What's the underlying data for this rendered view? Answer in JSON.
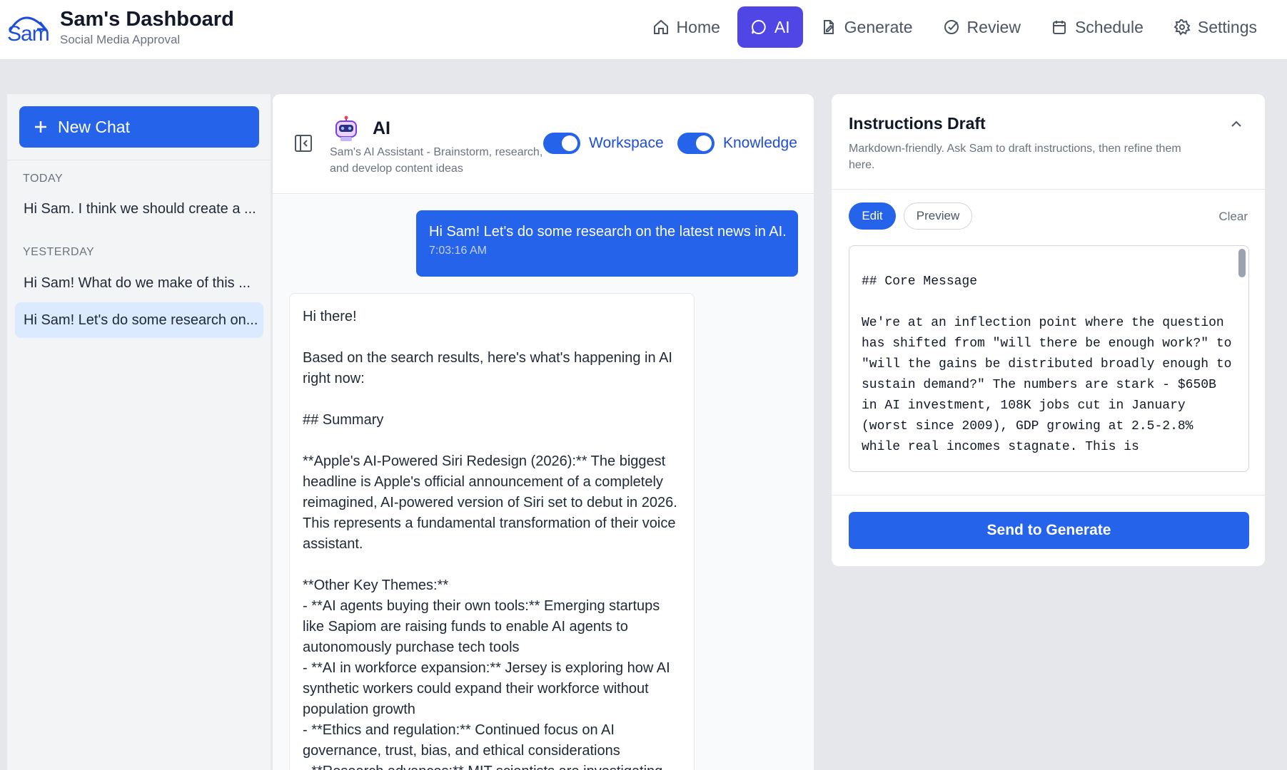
{
  "brand": {
    "logo_text": "Sam",
    "title": "Sam's Dashboard",
    "subtitle": "Social Media Approval"
  },
  "nav": {
    "items": [
      {
        "label": "Home",
        "icon": "home-icon",
        "active": false
      },
      {
        "label": "AI",
        "icon": "chat-icon",
        "active": true
      },
      {
        "label": "Generate",
        "icon": "document-pen-icon",
        "active": false
      },
      {
        "label": "Review",
        "icon": "check-circle-icon",
        "active": false
      },
      {
        "label": "Schedule",
        "icon": "calendar-icon",
        "active": false
      },
      {
        "label": "Settings",
        "icon": "gear-icon",
        "active": false
      }
    ]
  },
  "sidebar": {
    "new_chat_label": "New Chat",
    "sections": [
      {
        "label": "TODAY",
        "items": [
          {
            "label": "Hi Sam. I think we should create a ...",
            "active": false
          }
        ]
      },
      {
        "label": "YESTERDAY",
        "items": [
          {
            "label": "Hi Sam! What do we make of this ...",
            "active": false
          },
          {
            "label": "Hi Sam! Let's do some research on...",
            "active": true
          }
        ]
      }
    ]
  },
  "chat": {
    "title": "AI",
    "description": "Sam's AI Assistant - Brainstorm, research, and develop content ideas",
    "toggles": [
      {
        "label": "Workspace",
        "on": true
      },
      {
        "label": "Knowledge",
        "on": true
      }
    ],
    "user_message": {
      "text": "Hi Sam! Let's do some research on the latest news in AI.",
      "time": "7:03:16 AM"
    },
    "ai_message": {
      "greeting": "Hi there!",
      "intro": "Based on the search results, here's what's happening in AI right now:",
      "summary_heading": "## Summary",
      "para1": "**Apple's AI-Powered Siri Redesign (2026):** The biggest headline is Apple's official announcement of a completely reimagined, AI-powered version of Siri set to debut in 2026. This represents a fundamental transformation of their voice assistant.",
      "themes_heading": "**Other Key Themes:**",
      "bullet1": "- **AI agents buying their own tools:** Emerging startups like Sapiom are raising funds to enable AI agents to autonomously purchase tech tools",
      "bullet2": "- **AI in workforce expansion:** Jersey is exploring how AI synthetic workers could expand their workforce without population growth",
      "bullet3": "- **Ethics and regulation:** Continued focus on AI governance, trust, bias, and ethical considerations",
      "bullet4": "- **Research advances:** MIT scientists are investigating"
    }
  },
  "instructions": {
    "title": "Instructions Draft",
    "description": "Markdown-friendly. Ask Sam to draft instructions, then refine them here.",
    "edit_label": "Edit",
    "preview_label": "Preview",
    "clear_label": "Clear",
    "editor_text": "## Core Message\n\nWe're at an inflection point where the question has shifted from \"will there be enough work?\" to \"will the gains be distributed broadly enough to sustain demand?\" The numbers are stark - $650B in AI investment, 108K jobs cut in January (worst since 2009), GDP growing at 2.5-2.8% while real incomes stagnate. This is",
    "send_label": "Send to Generate"
  },
  "colors": {
    "primary": "#2563eb",
    "nav_active": "#4f46e5",
    "background": "#e5e7eb"
  }
}
